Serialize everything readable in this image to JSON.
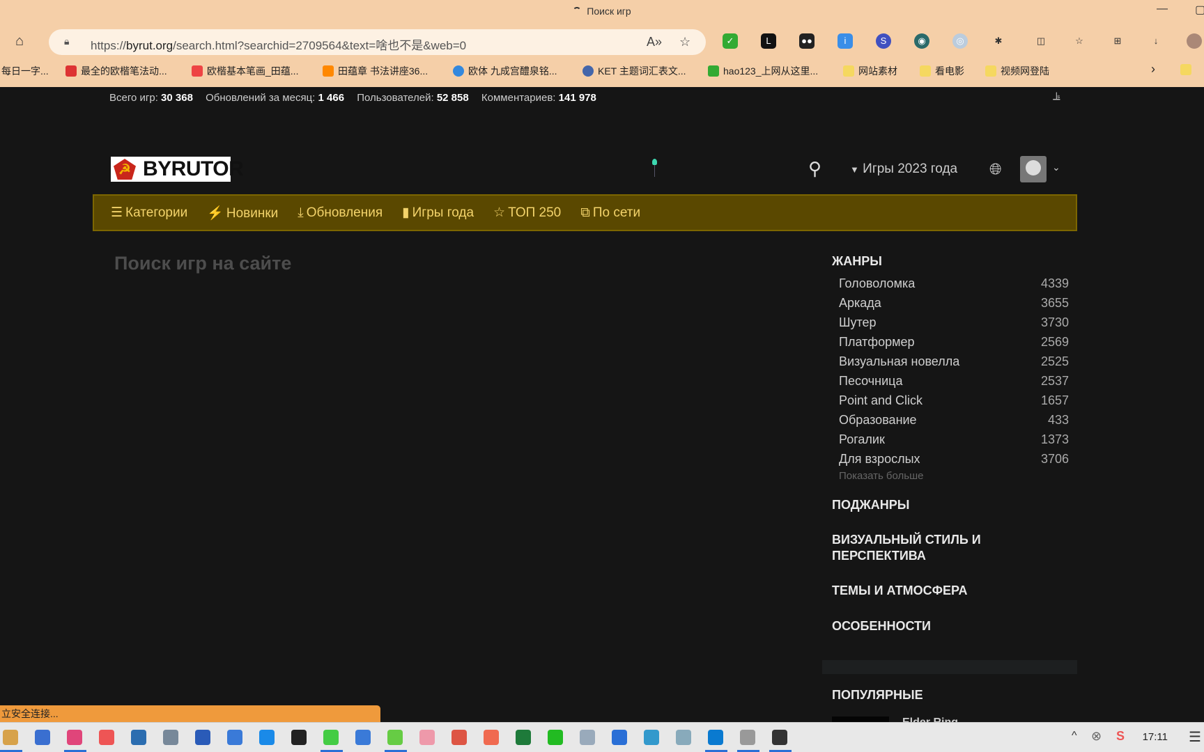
{
  "browser": {
    "title": "Поиск игр",
    "url_prefix": "https://",
    "url_domain": "byrut.org",
    "url_rest": "/search.html?searchid=2709564&text=啥也不是&web=0",
    "bookmarks": [
      {
        "label": "每日一字...",
        "color": "#fff"
      },
      {
        "label": "最全的欧楷笔法动...",
        "color": "#d33"
      },
      {
        "label": "欧楷基本笔画_田蕴...",
        "color": "#e44"
      },
      {
        "label": "田蕴章 书法讲座36...",
        "color": "#f80"
      },
      {
        "label": "欧体 九成宫醴泉铭...",
        "color": "#38d"
      },
      {
        "label": "KET 主题词汇表文...",
        "color": "#46a"
      },
      {
        "label": "hao123_上网从这里...",
        "color": "#3a3"
      },
      {
        "label": "网站素材",
        "color": "#f5d860"
      },
      {
        "label": "看电影",
        "color": "#f5d860"
      },
      {
        "label": "视频网登陆",
        "color": "#f5d860"
      }
    ],
    "status": "立安全连接...",
    "clock": "17:11"
  },
  "stats": [
    {
      "label": "Всего игр:",
      "value": "30 368"
    },
    {
      "label": "Обновлений за месяц:",
      "value": "1 466"
    },
    {
      "label": "Пользователей:",
      "value": "52 858"
    },
    {
      "label": "Комментариев:",
      "value": "141 978"
    }
  ],
  "header": {
    "logo": "BYRUTOR",
    "year_menu": "Игры 2023 года"
  },
  "nav": [
    {
      "icon": "☰",
      "label": "Категории"
    },
    {
      "icon": "⚡",
      "label": "Новинки"
    },
    {
      "icon": "⤓",
      "label": "Обновления"
    },
    {
      "icon": "▮",
      "label": "Игры года"
    },
    {
      "icon": "☆",
      "label": "ТОП 250"
    },
    {
      "icon": "⧉",
      "label": "По сети"
    }
  ],
  "main": {
    "title": "Поиск игр на сайте"
  },
  "sidebar": {
    "genres_title": "ЖАНРЫ",
    "genres": [
      {
        "name": "Головоломка",
        "count": "4339"
      },
      {
        "name": "Аркада",
        "count": "3655"
      },
      {
        "name": "Шутер",
        "count": "3730"
      },
      {
        "name": "Платформер",
        "count": "2569"
      },
      {
        "name": "Визуальная новелла",
        "count": "2525"
      },
      {
        "name": "Песочница",
        "count": "2537"
      },
      {
        "name": "Point and Click",
        "count": "1657"
      },
      {
        "name": "Образование",
        "count": "433"
      },
      {
        "name": "Рогалик",
        "count": "1373"
      },
      {
        "name": "Для взрослых",
        "count": "3706"
      }
    ],
    "show_more": "Показать больше",
    "subgenres": "ПОДЖАНРЫ",
    "visual": "ВИЗУАЛЬНЫЙ СТИЛЬ И ПЕРСПЕКТИВА",
    "themes": "ТЕМЫ И АТМОСФЕРА",
    "features": "ОСОБЕННОСТИ",
    "popular": "ПОПУЛЯРНЫЕ",
    "popular_first": "Elder Ring"
  },
  "colors": {
    "nav_bg": "#5a4800",
    "nav_text": "#f3d36b",
    "page_bg": "#151515",
    "chrome": "#f5cfa8"
  }
}
